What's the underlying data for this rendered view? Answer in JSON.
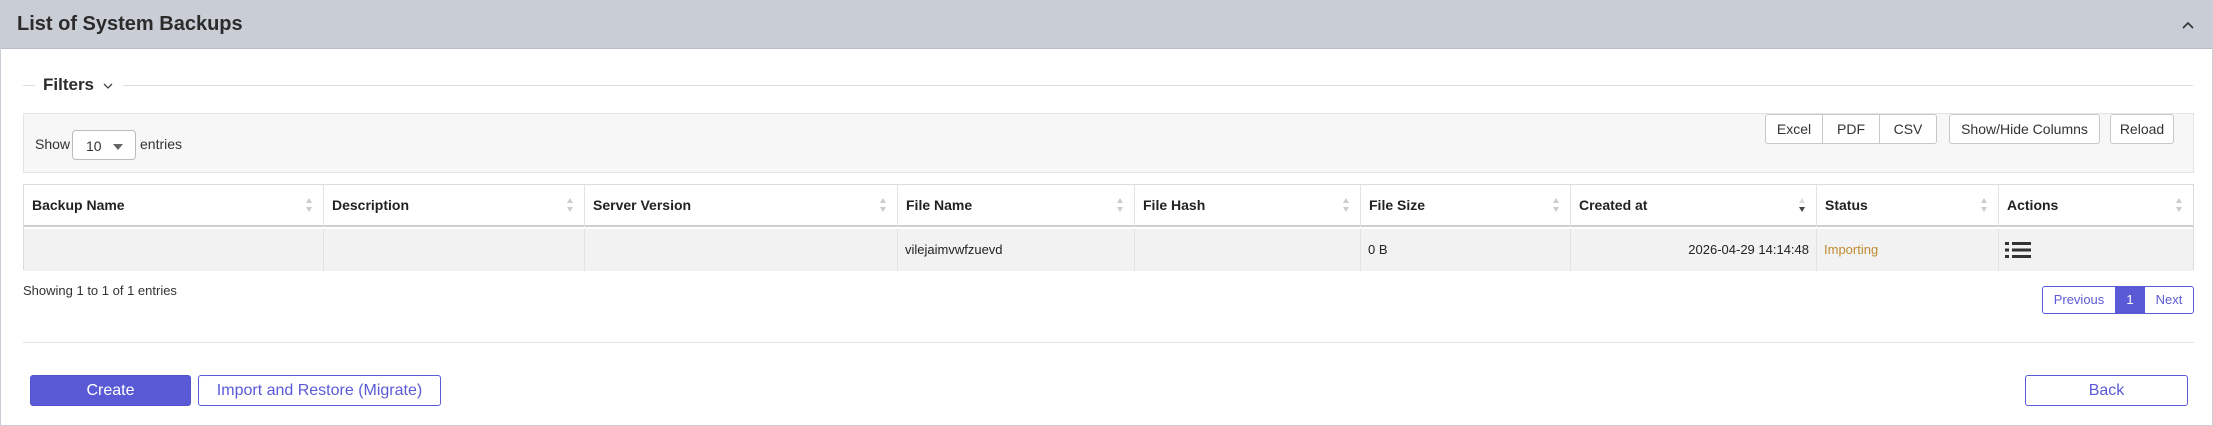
{
  "panel": {
    "title": "List of System Backups",
    "collapse_icon": "chevron-up-icon"
  },
  "filters": {
    "label": "Filters",
    "icon": "chevron-down-icon"
  },
  "toolbar": {
    "show_label": "Show",
    "length_value": "10",
    "entries_label": "entries",
    "export_buttons": [
      "Excel",
      "PDF",
      "CSV"
    ],
    "show_hide_label": "Show/Hide Columns",
    "reload_label": "Reload"
  },
  "table": {
    "columns": [
      "Backup Name",
      "Description",
      "Server Version",
      "File Name",
      "File Hash",
      "File Size",
      "Created at",
      "Status",
      "Actions"
    ],
    "sorted_column": "Created at",
    "sort_direction": "desc",
    "rows": [
      {
        "backup_name": "",
        "description": "",
        "server_version": "",
        "file_name": "vilejaimvwfzuevd",
        "file_hash": "",
        "file_size": "0 B",
        "created_at": "2026-04-29 14:14:48",
        "status": "Importing",
        "actions_icon": "list-icon"
      }
    ]
  },
  "info": "Showing 1 to 1 of 1 entries",
  "pagination": {
    "previous": "Previous",
    "current": "1",
    "next": "Next"
  },
  "footer": {
    "create_label": "Create",
    "import_label": "Import and Restore (Migrate)",
    "back_label": "Back"
  },
  "colors": {
    "accent": "#5a5ad6",
    "header_bg": "#c9ced6",
    "status_importing": "#c08a2e"
  }
}
